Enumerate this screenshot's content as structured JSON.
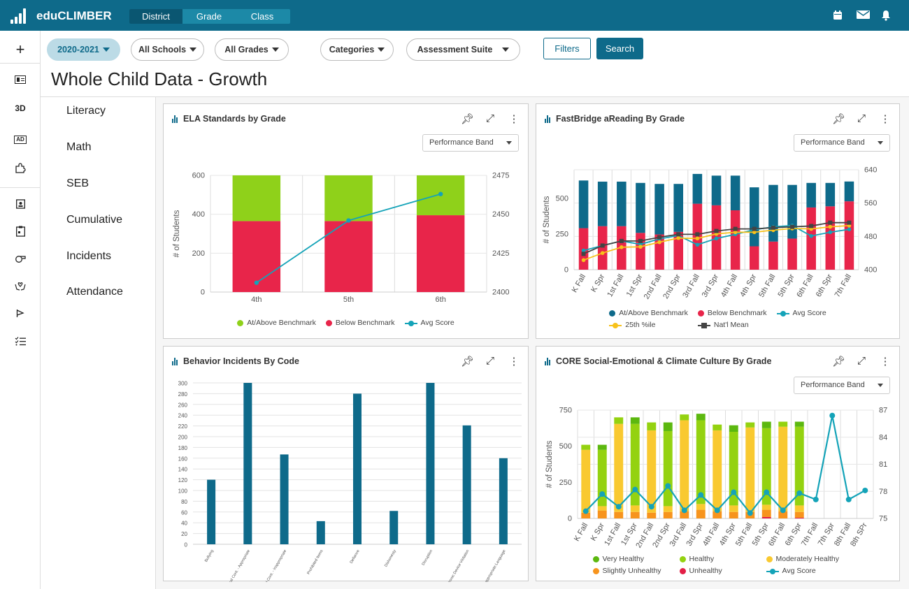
{
  "app": {
    "brand": "eduCLIMBER"
  },
  "nav": {
    "tabs": [
      {
        "label": "District",
        "active": true
      },
      {
        "label": "Grade"
      },
      {
        "label": "Class"
      }
    ]
  },
  "header_icons": [
    "calendar-icon",
    "mail-icon",
    "bell-icon"
  ],
  "rail": {
    "plus": "+",
    "three_d": "3D",
    "ad": "AD"
  },
  "filters": {
    "year": "2020-2021",
    "schools": "All Schools",
    "grades": "All Grades",
    "categories": "Categories",
    "suite": "Assessment Suite",
    "filters_btn": "Filters",
    "search_btn": "Search"
  },
  "page_title": "Whole Child Data - Growth",
  "subnav": [
    "Literacy",
    "Math",
    "SEB",
    "Cumulative",
    "Incidents",
    "Attendance"
  ],
  "colors": {
    "brand": "#0e6a8a",
    "red": "#e8254a",
    "green": "#8fd11a",
    "teal": "#14a3b8",
    "yellow": "#f7c21b"
  },
  "panels": [
    {
      "title": "ELA Standards by Grade",
      "dropdown": "Performance Band"
    },
    {
      "title": "FastBridge aReading By Grade",
      "dropdown": "Performance Band"
    },
    {
      "title": "Behavior Incidents By Code"
    },
    {
      "title": "CORE Social-Emotional & Climate Culture By Grade",
      "dropdown": "Performance Band"
    }
  ],
  "chart_data": [
    {
      "type": "bar",
      "title": "ELA Standards by Grade",
      "ylabel": "# of Students",
      "categories": [
        "4th",
        "5th",
        "6th"
      ],
      "ylim": [
        0,
        600
      ],
      "yticks": [
        0,
        200,
        400,
        600
      ],
      "y2lim": [
        2400,
        2475
      ],
      "y2ticks": [
        2400,
        2425,
        2450,
        2475
      ],
      "series": [
        {
          "name": "Below Benchmark",
          "type": "bar",
          "color": "#e8254a",
          "values": [
            365,
            365,
            395
          ],
          "legend_order": 1
        },
        {
          "name": "At/Above Benchmark",
          "type": "bar",
          "color": "#8fd11a",
          "values": [
            235,
            235,
            205
          ],
          "legend_order": 0
        },
        {
          "name": "Avg Score",
          "type": "line",
          "axis": "right",
          "color": "#14a3b8",
          "marker": "circle",
          "values": [
            2406,
            2446,
            2463
          ],
          "legend_order": 2
        }
      ]
    },
    {
      "type": "bar",
      "title": "FastBridge aReading By Grade",
      "ylabel": "# of Students",
      "categories": [
        "K Fall",
        "K Spr",
        "1st Fall",
        "1st Spr",
        "2nd Fall",
        "2nd Spr",
        "3rd Fall",
        "3rd Spr",
        "4th Fall",
        "4th Spr",
        "5th Fall",
        "5th Spr",
        "6th Fall",
        "6th Spr",
        "7th Fall"
      ],
      "ylim": [
        0,
        700
      ],
      "yticks": [
        0,
        250,
        500
      ],
      "y2lim": [
        400,
        640
      ],
      "y2ticks": [
        400,
        480,
        560,
        640
      ],
      "series": [
        {
          "name": "Below Benchmark",
          "type": "bar",
          "color": "#e8254a",
          "values": [
            291,
            305,
            305,
            258,
            247,
            265,
            462,
            451,
            416,
            164,
            197,
            218,
            436,
            444,
            479
          ],
          "legend_order": 1
        },
        {
          "name": "At/Above Benchmark",
          "type": "bar",
          "color": "#0e6a8a",
          "values": [
            334,
            312,
            312,
            350,
            354,
            336,
            209,
            208,
            243,
            413,
            397,
            376,
            172,
            164,
            139
          ],
          "legend_order": 0
        },
        {
          "name": "Avg Score",
          "type": "line",
          "axis": "right",
          "color": "#14a3b8",
          "marker": "circle",
          "values": [
            446,
            458,
            469,
            461,
            474,
            482,
            460,
            475,
            485,
            496,
            503,
            506,
            481,
            490,
            497
          ],
          "legend_order": 2
        },
        {
          "name": "25th %ile",
          "type": "line",
          "axis": "right",
          "color": "#f7c21b",
          "marker": "circle",
          "values": [
            423,
            440,
            454,
            455,
            466,
            476,
            475,
            486,
            490,
            490,
            495,
            499,
            498,
            503,
            506
          ],
          "legend_order": 3
        },
        {
          "name": "Nat'l Mean",
          "type": "line",
          "axis": "right",
          "color": "#444444",
          "marker": "square",
          "values": [
            438,
            458,
            469,
            469,
            478,
            485,
            485,
            493,
            498,
            498,
            501,
            503,
            505,
            513,
            513
          ],
          "legend_order": 4
        }
      ]
    },
    {
      "type": "bar",
      "title": "Behavior Incidents By Code",
      "categories": [
        "Bullying",
        "Physical Cont. - Appropriate",
        "Physical Cont. - Inappropriate",
        "Prohibited Items",
        "Defiance",
        "Dishonesty",
        "Disruption",
        "Electronic Device Violation",
        "Inappropriate Language"
      ],
      "ylim": [
        0,
        300
      ],
      "yticks": [
        0,
        20,
        40,
        60,
        80,
        100,
        120,
        140,
        160,
        180,
        200,
        220,
        240,
        260,
        280,
        300
      ],
      "series": [
        {
          "name": "Incidents",
          "type": "bar",
          "color": "#0e6a8a",
          "values": [
            120,
            300,
            167,
            43,
            280,
            62,
            300,
            221,
            160
          ]
        }
      ]
    },
    {
      "type": "bar",
      "title": "CORE Social-Emotional & Climate Culture By Grade",
      "ylabel": "# of Students",
      "categories": [
        "K Fall",
        "K Spr",
        "1st Fall",
        "1st Spr",
        "2nd Fall",
        "2nd Spr",
        "3rd Fall",
        "3rd Spr",
        "4th Fall",
        "4th Spr",
        "5th Fall",
        "5th Spr",
        "6th Fall",
        "6th Spr",
        "7th Fall",
        "7th Spr",
        "8th Fall",
        "8th SPr"
      ],
      "ylim": [
        0,
        750
      ],
      "yticks": [
        0,
        250,
        500,
        750
      ],
      "y2lim": [
        75,
        87
      ],
      "y2ticks": [
        75,
        78,
        81,
        84,
        87
      ],
      "series": [
        {
          "name": "Unhealthy",
          "type": "bar",
          "color": "#e31f46",
          "values": [
            0,
            0,
            0,
            0,
            0,
            0,
            0,
            0,
            0,
            0,
            0,
            10,
            0,
            5,
            0,
            0,
            0,
            0
          ],
          "legend_order": 4
        },
        {
          "name": "Slightly Unhealthy",
          "type": "bar",
          "color": "#f7941d",
          "values": [
            40,
            55,
            45,
            45,
            40,
            45,
            50,
            60,
            50,
            45,
            45,
            50,
            50,
            40,
            0,
            0,
            0,
            0
          ],
          "legend_order": 3
        },
        {
          "name": "Moderately Healthy",
          "type": "bar",
          "color": "#f9c930",
          "values": [
            435,
            30,
            610,
            45,
            570,
            40,
            630,
            40,
            560,
            45,
            585,
            35,
            585,
            45,
            0,
            0,
            0,
            0
          ],
          "legend_order": 2
        },
        {
          "name": "Healthy",
          "type": "bar",
          "color": "#94d210",
          "values": [
            35,
            390,
            45,
            565,
            55,
            520,
            40,
            580,
            40,
            510,
            35,
            530,
            35,
            545,
            0,
            0,
            0,
            0
          ],
          "legend_order": 1
        },
        {
          "name": "Very Healthy",
          "type": "bar",
          "color": "#5cb80f",
          "values": [
            0,
            35,
            0,
            45,
            0,
            60,
            0,
            45,
            0,
            45,
            0,
            45,
            0,
            35,
            0,
            0,
            0,
            0
          ],
          "legend_order": 0
        },
        {
          "name": "Avg Score",
          "type": "line",
          "axis": "right",
          "color": "#14a3b8",
          "marker": "circle",
          "values": [
            75.8,
            77.7,
            76.3,
            78.2,
            76.3,
            78.6,
            75.9,
            77.6,
            75.9,
            77.9,
            75.6,
            77.9,
            75.9,
            77.8,
            77.1,
            86.4,
            77.1,
            78.1
          ],
          "legend_order": 5
        }
      ]
    }
  ]
}
